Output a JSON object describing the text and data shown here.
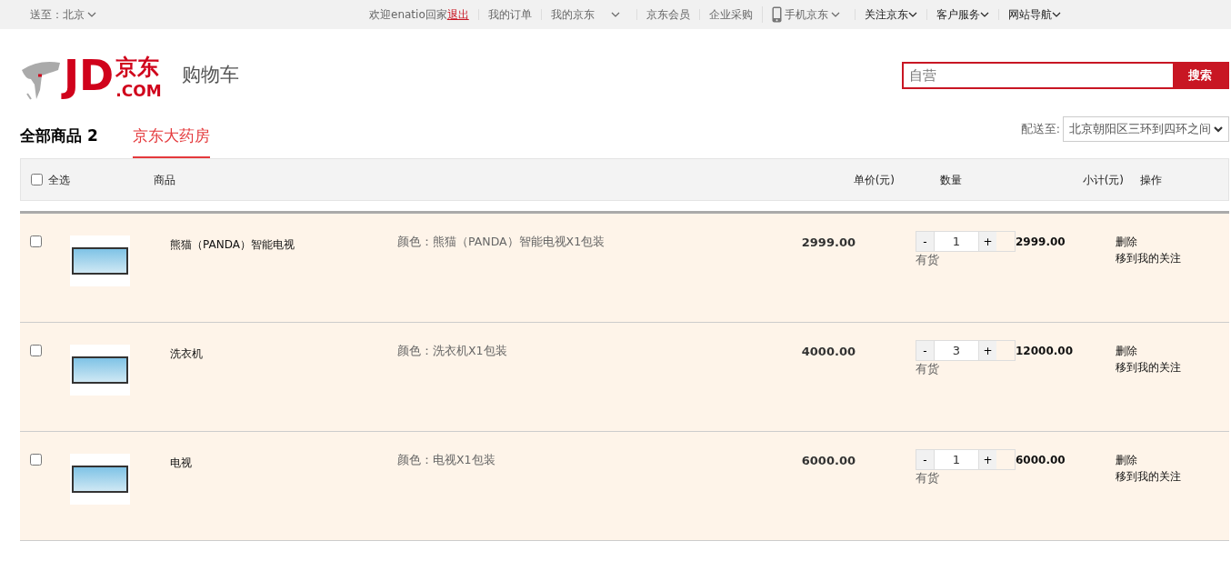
{
  "top_bar": {
    "location": "送至：北京",
    "welcome": "欢迎enatio回家",
    "logout": "退出",
    "links": [
      {
        "label": "我的订单",
        "kind": "plain"
      },
      {
        "label": "我的京东",
        "kind": "dropdown"
      },
      {
        "label": "京东会员",
        "kind": "plain"
      },
      {
        "label": "企业采购",
        "kind": "plain"
      },
      {
        "label": "手机京东",
        "kind": "phone"
      },
      {
        "label": "关注京东",
        "kind": "dropdown_dark"
      },
      {
        "label": "客户服务",
        "kind": "dropdown_dark"
      },
      {
        "label": "网站导航",
        "kind": "dropdown_dark"
      }
    ]
  },
  "header": {
    "logo": {
      "mark": "JD",
      "cn": "京东",
      "com": ".COM"
    },
    "title": "购物车",
    "search": {
      "placeholder": "自营",
      "button": "搜索"
    }
  },
  "tabs": [
    {
      "label": "全部商品",
      "count": "2",
      "selected": false
    },
    {
      "label": "京东大药房",
      "selected": true
    }
  ],
  "delivery": {
    "label": "配送至:",
    "value": "北京朝阳区三环到四环之间"
  },
  "table": {
    "select_all": {
      "label": "全选",
      "checked": false
    },
    "columns": [
      "商品",
      "单价(元)",
      "数量",
      "小计(元)",
      "操作"
    ],
    "rows": [
      {
        "checked": false,
        "name": "熊猫（PANDA）智能电视",
        "spec": "颜色：熊猫（PANDA）智能电视X1包装",
        "price": "2999.00",
        "decrease": "-",
        "quantity": "1",
        "increase": "+",
        "stock": "有货",
        "subtotal": "2999.00",
        "actions": [
          "删除",
          "移到我的关注"
        ]
      },
      {
        "checked": false,
        "name": "洗衣机",
        "spec": "颜色：洗衣机X1包装",
        "price": "4000.00",
        "decrease": "-",
        "quantity": "3",
        "increase": "+",
        "stock": "有货",
        "subtotal": "12000.00",
        "actions": [
          "删除",
          "移到我的关注"
        ]
      },
      {
        "checked": false,
        "name": "电视",
        "spec": "颜色：电视X1包装",
        "price": "6000.00",
        "decrease": "-",
        "quantity": "1",
        "increase": "+",
        "stock": "有货",
        "subtotal": "6000.00",
        "actions": [
          "删除",
          "移到我的关注"
        ]
      }
    ]
  }
}
